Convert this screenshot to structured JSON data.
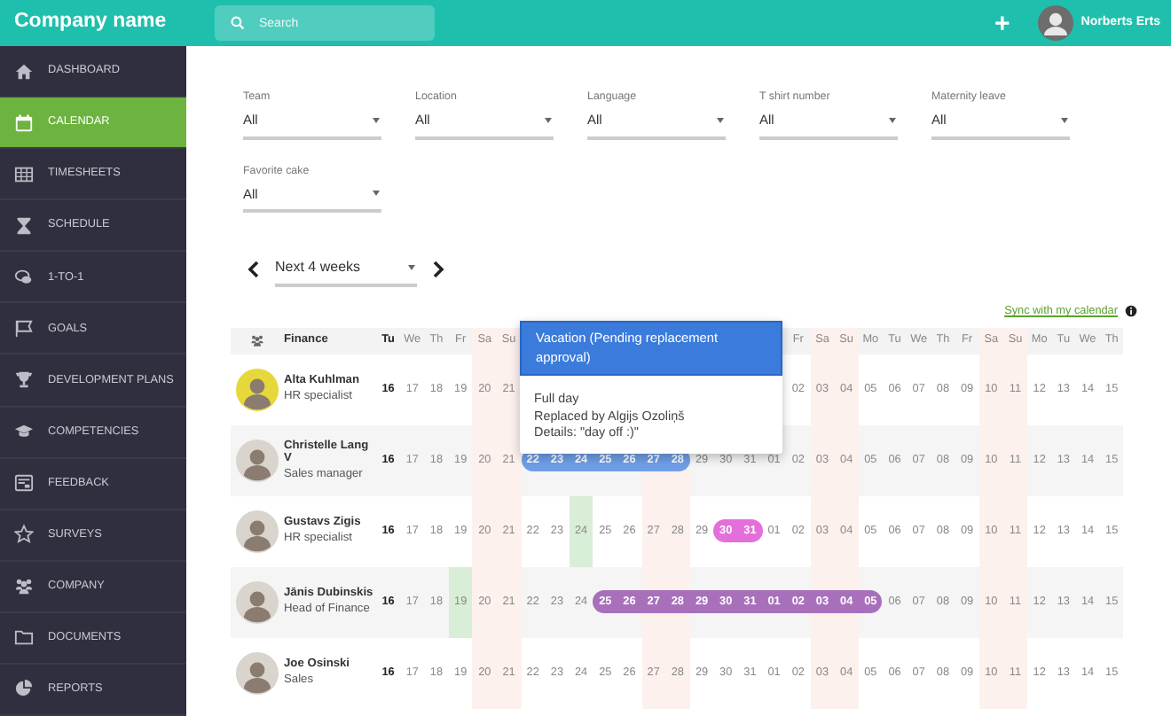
{
  "topbar": {
    "brand": "Company name",
    "search": {
      "placeholder": "Search"
    },
    "add_button": "+",
    "user": {
      "name": "Norberts Erts"
    }
  },
  "sidebar": {
    "items": [
      {
        "label": "DASHBOARD",
        "selected": false
      },
      {
        "label": "CALENDAR",
        "selected": true
      },
      {
        "label": "TIMESHEETS",
        "selected": false
      },
      {
        "label": "SCHEDULE",
        "selected": false
      },
      {
        "label": "1-TO-1",
        "selected": false
      },
      {
        "label": "GOALS",
        "selected": false
      },
      {
        "label": "DEVELOPMENT PLANS",
        "selected": false
      },
      {
        "label": "COMPETENCIES",
        "selected": false
      },
      {
        "label": "FEEDBACK",
        "selected": false
      },
      {
        "label": "SURVEYS",
        "selected": false
      },
      {
        "label": "COMPANY",
        "selected": false
      },
      {
        "label": "DOCUMENTS",
        "selected": false
      },
      {
        "label": "REPORTS",
        "selected": false
      }
    ]
  },
  "filters": [
    {
      "label": "Team",
      "value": "All"
    },
    {
      "label": "Location",
      "value": "All"
    },
    {
      "label": "Language",
      "value": "All"
    },
    {
      "label": "T shirt number",
      "value": "All"
    },
    {
      "label": "Maternity leave",
      "value": "All"
    },
    {
      "label": "Favorite cake",
      "value": "All"
    }
  ],
  "period": {
    "value": "Next 4 weeks"
  },
  "sync_link": "Sync with my calendar",
  "calendar": {
    "team": "Finance",
    "columns": [
      {
        "weekday": "Tu",
        "weekend": false,
        "today": true
      },
      {
        "weekday": "We",
        "weekend": false,
        "today": false
      },
      {
        "weekday": "Th",
        "weekend": false,
        "today": false
      },
      {
        "weekday": "Fr",
        "weekend": false,
        "today": false
      },
      {
        "weekday": "Sa",
        "weekend": true,
        "today": false
      },
      {
        "weekday": "Su",
        "weekend": true,
        "today": false
      },
      {
        "weekend": false,
        "today": false
      },
      {
        "weekend": false,
        "today": false
      },
      {
        "weekend": false,
        "today": false
      },
      {
        "weekend": false,
        "today": false
      },
      {
        "weekend": false,
        "today": false
      },
      {
        "weekend": true,
        "today": false
      },
      {
        "weekend": true,
        "today": false
      },
      {
        "weekend": false,
        "today": false
      },
      {
        "weekend": false,
        "today": false
      },
      {
        "weekend": false,
        "today": false
      },
      {
        "weekend": false,
        "today": false
      },
      {
        "weekday": "Fr",
        "weekend": false,
        "today": false
      },
      {
        "weekday": "Sa",
        "weekend": true,
        "today": false
      },
      {
        "weekday": "Su",
        "weekend": true,
        "today": false
      },
      {
        "weekday": "Mo",
        "weekend": false,
        "today": false
      },
      {
        "weekday": "Tu",
        "weekend": false,
        "today": false
      },
      {
        "weekday": "We",
        "weekend": false,
        "today": false
      },
      {
        "weekday": "Th",
        "weekend": false,
        "today": false
      },
      {
        "weekday": "Fr",
        "weekend": false,
        "today": false
      },
      {
        "weekday": "Sa",
        "weekend": true,
        "today": false
      },
      {
        "weekday": "Su",
        "weekend": true,
        "today": false
      },
      {
        "weekday": "Mo",
        "weekend": false,
        "today": false
      },
      {
        "weekday": "Tu",
        "weekend": false,
        "today": false
      },
      {
        "weekday": "We",
        "weekend": false,
        "today": false
      },
      {
        "weekday": "Th",
        "weekend": false,
        "today": false
      }
    ],
    "rows": [
      {
        "name": "Alta Kuhlman",
        "title": "HR specialist",
        "cells": [
          {
            "kind": "day",
            "date": "16"
          },
          {
            "kind": "day",
            "date": "17"
          },
          {
            "kind": "day",
            "date": "18"
          },
          {
            "kind": "day",
            "date": "19"
          },
          {
            "kind": "day",
            "date": "20"
          },
          {
            "kind": "day",
            "date": "21"
          },
          {
            "kind": "day"
          },
          {
            "kind": "day"
          },
          {
            "kind": "day"
          },
          {
            "kind": "day"
          },
          {
            "kind": "day"
          },
          {
            "kind": "day"
          },
          {
            "kind": "day"
          },
          {
            "kind": "day"
          },
          {
            "kind": "day"
          },
          {
            "kind": "day"
          },
          {
            "kind": "day"
          },
          {
            "kind": "day",
            "date": "02"
          },
          {
            "kind": "day",
            "date": "03"
          },
          {
            "kind": "day",
            "date": "04"
          },
          {
            "kind": "day",
            "date": "05"
          },
          {
            "kind": "day",
            "date": "06"
          },
          {
            "kind": "day",
            "date": "07"
          },
          {
            "kind": "day",
            "date": "08"
          },
          {
            "kind": "day",
            "date": "09"
          },
          {
            "kind": "day",
            "date": "10"
          },
          {
            "kind": "day",
            "date": "11"
          },
          {
            "kind": "day",
            "date": "12"
          },
          {
            "kind": "day",
            "date": "13"
          },
          {
            "kind": "day",
            "date": "14"
          },
          {
            "kind": "day",
            "date": "15"
          }
        ]
      },
      {
        "name": "Christelle Lang V",
        "title": "Sales manager",
        "cells": [
          {
            "kind": "day",
            "date": "16"
          },
          {
            "kind": "day",
            "date": "17"
          },
          {
            "kind": "day",
            "date": "18"
          },
          {
            "kind": "day",
            "date": "19"
          },
          {
            "kind": "day",
            "date": "20"
          },
          {
            "kind": "day",
            "date": "21"
          },
          {
            "kind": "leave",
            "date": "22",
            "color": "#6f9ee6"
          },
          {
            "kind": "leave",
            "date": "23",
            "color": "#6f9ee6"
          },
          {
            "kind": "leave",
            "date": "24",
            "color": "#6f9ee6"
          },
          {
            "kind": "leave",
            "date": "25",
            "color": "#6f9ee6"
          },
          {
            "kind": "leave",
            "date": "26",
            "color": "#6f9ee6"
          },
          {
            "kind": "leave",
            "date": "27",
            "color": "#6f9ee6"
          },
          {
            "kind": "leave",
            "date": "28",
            "color": "#6f9ee6"
          },
          {
            "kind": "day",
            "date": "29"
          },
          {
            "kind": "day",
            "date": "30"
          },
          {
            "kind": "day",
            "date": "31"
          },
          {
            "kind": "day",
            "date": "01"
          },
          {
            "kind": "day",
            "date": "02"
          },
          {
            "kind": "day",
            "date": "03"
          },
          {
            "kind": "day",
            "date": "04"
          },
          {
            "kind": "day",
            "date": "05"
          },
          {
            "kind": "day",
            "date": "06"
          },
          {
            "kind": "day",
            "date": "07"
          },
          {
            "kind": "day",
            "date": "08"
          },
          {
            "kind": "day",
            "date": "09"
          },
          {
            "kind": "day",
            "date": "10"
          },
          {
            "kind": "day",
            "date": "11"
          },
          {
            "kind": "day",
            "date": "12"
          },
          {
            "kind": "day",
            "date": "13"
          },
          {
            "kind": "day",
            "date": "14"
          },
          {
            "kind": "day",
            "date": "15"
          }
        ]
      },
      {
        "name": "Gustavs Zigis",
        "title": "HR specialist",
        "cells": [
          {
            "kind": "day",
            "date": "16"
          },
          {
            "kind": "day",
            "date": "17"
          },
          {
            "kind": "day",
            "date": "18"
          },
          {
            "kind": "day",
            "date": "19"
          },
          {
            "kind": "day",
            "date": "20"
          },
          {
            "kind": "day",
            "date": "21"
          },
          {
            "kind": "day",
            "date": "22"
          },
          {
            "kind": "day",
            "date": "23"
          },
          {
            "kind": "holiday",
            "date": "24"
          },
          {
            "kind": "day",
            "date": "25"
          },
          {
            "kind": "day",
            "date": "26"
          },
          {
            "kind": "day",
            "date": "27"
          },
          {
            "kind": "day",
            "date": "28"
          },
          {
            "kind": "day",
            "date": "29"
          },
          {
            "kind": "leave",
            "date": "30",
            "color": "#e46fdb"
          },
          {
            "kind": "leave",
            "date": "31",
            "color": "#e46fdb"
          },
          {
            "kind": "day",
            "date": "01"
          },
          {
            "kind": "day",
            "date": "02"
          },
          {
            "kind": "day",
            "date": "03"
          },
          {
            "kind": "day",
            "date": "04"
          },
          {
            "kind": "day",
            "date": "05"
          },
          {
            "kind": "day",
            "date": "06"
          },
          {
            "kind": "day",
            "date": "07"
          },
          {
            "kind": "day",
            "date": "08"
          },
          {
            "kind": "day",
            "date": "09"
          },
          {
            "kind": "day",
            "date": "10"
          },
          {
            "kind": "day",
            "date": "11"
          },
          {
            "kind": "day",
            "date": "12"
          },
          {
            "kind": "day",
            "date": "13"
          },
          {
            "kind": "day",
            "date": "14"
          },
          {
            "kind": "day",
            "date": "15"
          }
        ]
      },
      {
        "name": "Jānis Dubinskis",
        "title": "Head of Finance",
        "cells": [
          {
            "kind": "day",
            "date": "16"
          },
          {
            "kind": "day",
            "date": "17"
          },
          {
            "kind": "day",
            "date": "18"
          },
          {
            "kind": "holiday",
            "date": "19"
          },
          {
            "kind": "day",
            "date": "20"
          },
          {
            "kind": "day",
            "date": "21"
          },
          {
            "kind": "day",
            "date": "22"
          },
          {
            "kind": "day",
            "date": "23"
          },
          {
            "kind": "day",
            "date": "24"
          },
          {
            "kind": "leave",
            "date": "25",
            "color": "#a870bb"
          },
          {
            "kind": "leave",
            "date": "26",
            "color": "#a870bb"
          },
          {
            "kind": "leave",
            "date": "27",
            "color": "#a870bb"
          },
          {
            "kind": "leave",
            "date": "28",
            "color": "#a870bb"
          },
          {
            "kind": "leave",
            "date": "29",
            "color": "#a870bb"
          },
          {
            "kind": "leave",
            "date": "30",
            "color": "#a870bb"
          },
          {
            "kind": "leave",
            "date": "31",
            "color": "#a870bb"
          },
          {
            "kind": "leave",
            "date": "01",
            "color": "#a870bb"
          },
          {
            "kind": "leave",
            "date": "02",
            "color": "#a870bb"
          },
          {
            "kind": "leave",
            "date": "03",
            "color": "#a870bb"
          },
          {
            "kind": "leave",
            "date": "04",
            "color": "#a870bb"
          },
          {
            "kind": "leave",
            "date": "05",
            "color": "#a870bb"
          },
          {
            "kind": "day",
            "date": "06"
          },
          {
            "kind": "day",
            "date": "07"
          },
          {
            "kind": "day",
            "date": "08"
          },
          {
            "kind": "day",
            "date": "09"
          },
          {
            "kind": "day",
            "date": "10"
          },
          {
            "kind": "day",
            "date": "11"
          },
          {
            "kind": "day",
            "date": "12"
          },
          {
            "kind": "day",
            "date": "13"
          },
          {
            "kind": "day",
            "date": "14"
          },
          {
            "kind": "day",
            "date": "15"
          }
        ]
      },
      {
        "name": "Joe Osinski",
        "title": "Sales",
        "cells": [
          {
            "kind": "day",
            "date": "16"
          },
          {
            "kind": "day",
            "date": "17"
          },
          {
            "kind": "day",
            "date": "18"
          },
          {
            "kind": "day",
            "date": "19"
          },
          {
            "kind": "day",
            "date": "20"
          },
          {
            "kind": "day",
            "date": "21"
          },
          {
            "kind": "day",
            "date": "22"
          },
          {
            "kind": "day",
            "date": "23"
          },
          {
            "kind": "day",
            "date": "24"
          },
          {
            "kind": "day",
            "date": "25"
          },
          {
            "kind": "day",
            "date": "26"
          },
          {
            "kind": "day",
            "date": "27"
          },
          {
            "kind": "day",
            "date": "28"
          },
          {
            "kind": "day",
            "date": "29"
          },
          {
            "kind": "day",
            "date": "30"
          },
          {
            "kind": "day",
            "date": "31"
          },
          {
            "kind": "day",
            "date": "01"
          },
          {
            "kind": "day",
            "date": "02"
          },
          {
            "kind": "day",
            "date": "03"
          },
          {
            "kind": "day",
            "date": "04"
          },
          {
            "kind": "day",
            "date": "05"
          },
          {
            "kind": "day",
            "date": "06"
          },
          {
            "kind": "day",
            "date": "07"
          },
          {
            "kind": "day",
            "date": "08"
          },
          {
            "kind": "day",
            "date": "09"
          },
          {
            "kind": "day",
            "date": "10"
          },
          {
            "kind": "day",
            "date": "11"
          },
          {
            "kind": "day",
            "date": "12"
          },
          {
            "kind": "day",
            "date": "13"
          },
          {
            "kind": "day",
            "date": "14"
          },
          {
            "kind": "day",
            "date": "15"
          }
        ]
      }
    ]
  },
  "tooltip": {
    "title": "Vacation (Pending replacement approval)",
    "lines": [
      "Full day",
      "Replaced by Algijs Ozoliņš",
      "Details: \"day off :)\""
    ]
  }
}
